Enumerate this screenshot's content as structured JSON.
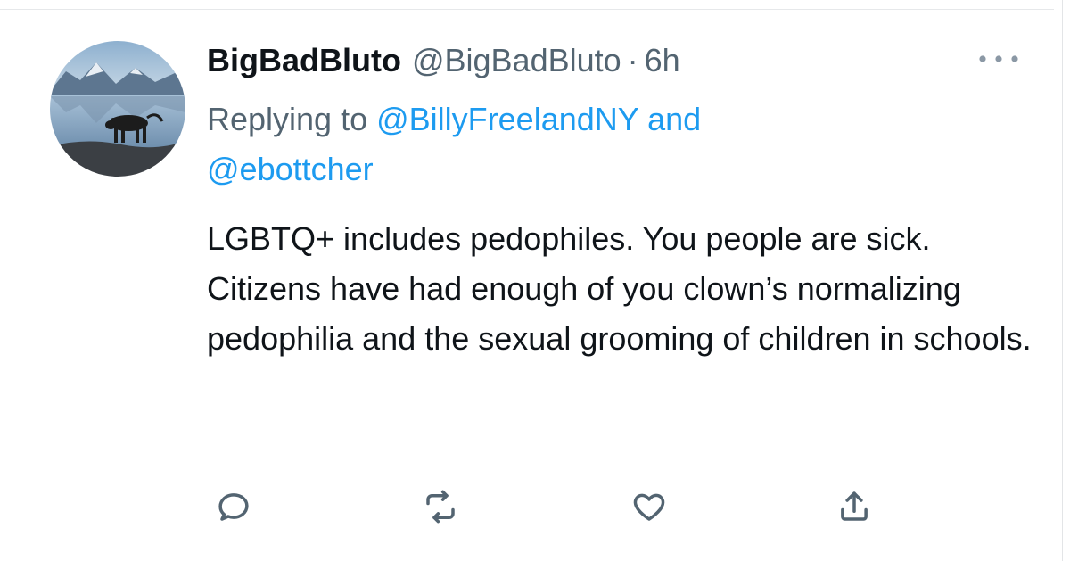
{
  "tweet": {
    "display_name": "BigBadBluto",
    "handle": "@BigBadBluto",
    "separator": "·",
    "time": "6h",
    "replying_prefix": "Replying to",
    "replying_mention_1": "@BillyFreelandNY",
    "replying_joiner": "and",
    "replying_mention_2": "@ebottcher",
    "text": "LGBTQ+ includes pedophiles.  You people are sick.\nCitizens have had enough of you clown’s normalizing pedophilia and the sexual grooming of children in schools."
  },
  "icons": {
    "more": "more-horizontal-icon",
    "reply": "reply-icon",
    "retweet": "retweet-icon",
    "like": "heart-icon",
    "share": "share-icon"
  },
  "colors": {
    "text": "#0f1419",
    "secondary": "#536471",
    "link": "#1d9bf0"
  }
}
